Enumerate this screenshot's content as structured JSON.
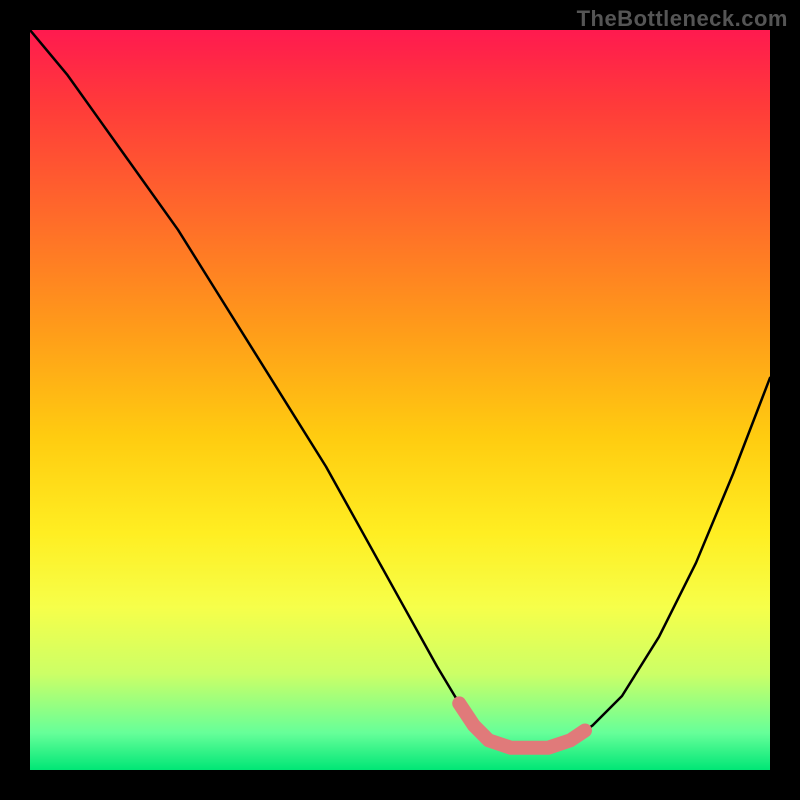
{
  "watermark": "TheBottleneck.com",
  "chart_data": {
    "type": "line",
    "title": "",
    "xlabel": "",
    "ylabel": "",
    "xlim": [
      0,
      100
    ],
    "ylim": [
      0,
      100
    ],
    "series": [
      {
        "name": "bottleneck-curve",
        "x": [
          0,
          5,
          10,
          15,
          20,
          25,
          30,
          35,
          40,
          45,
          50,
          55,
          58,
          60,
          62,
          65,
          68,
          70,
          73,
          76,
          80,
          85,
          90,
          95,
          100
        ],
        "values": [
          100,
          94,
          87,
          80,
          73,
          65,
          57,
          49,
          41,
          32,
          23,
          14,
          9,
          6,
          4,
          3,
          3,
          3,
          4,
          6,
          10,
          18,
          28,
          40,
          53
        ]
      }
    ],
    "highlight_band": {
      "name": "optimal-range",
      "x_start": 58,
      "x_end": 75,
      "value": 3,
      "color": "#e07a7a"
    },
    "gradient_stops": [
      {
        "pos": 0,
        "color": "#ff1a4f"
      },
      {
        "pos": 10,
        "color": "#ff3a3a"
      },
      {
        "pos": 25,
        "color": "#ff6a2a"
      },
      {
        "pos": 40,
        "color": "#ff9a1a"
      },
      {
        "pos": 55,
        "color": "#ffcc10"
      },
      {
        "pos": 68,
        "color": "#ffee22"
      },
      {
        "pos": 78,
        "color": "#f6ff4a"
      },
      {
        "pos": 87,
        "color": "#ccff66"
      },
      {
        "pos": 95,
        "color": "#66ff99"
      },
      {
        "pos": 100,
        "color": "#00e676"
      }
    ]
  }
}
